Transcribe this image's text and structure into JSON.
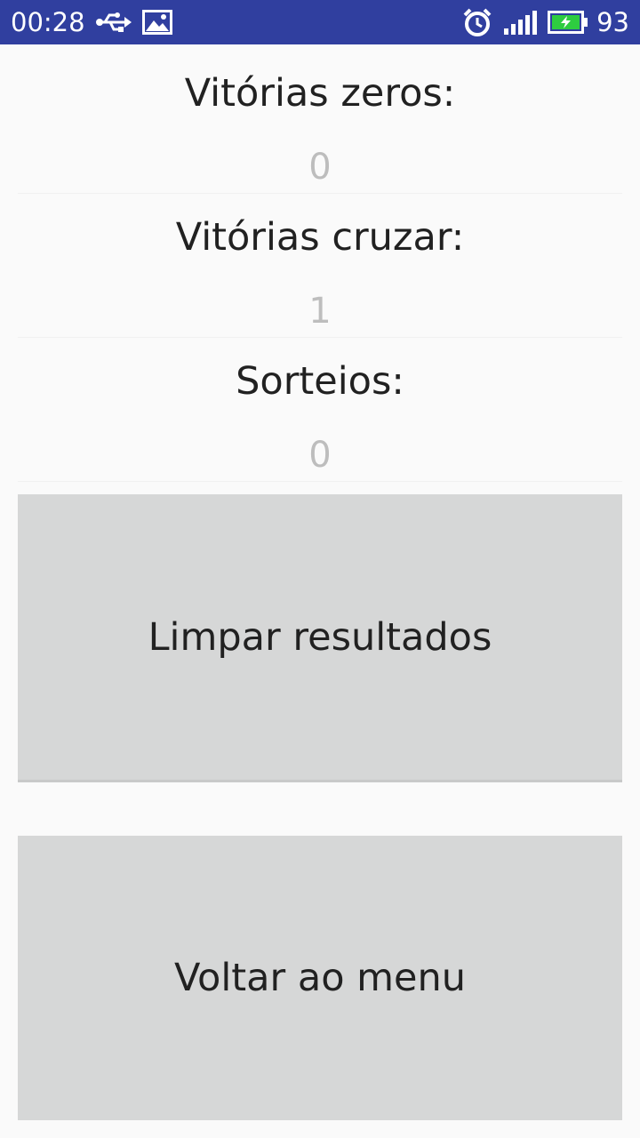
{
  "status_bar": {
    "time": "00:28",
    "battery_level": "93",
    "icons": [
      "usb-icon",
      "image-icon",
      "alarm-icon",
      "signal-icon",
      "battery-charging-icon"
    ],
    "background_color": "#303f9f"
  },
  "stats": [
    {
      "label": "Vitórias zeros:",
      "value": "0"
    },
    {
      "label": "Vitórias cruzar:",
      "value": "1"
    },
    {
      "label": "Sorteios:",
      "value": "0"
    }
  ],
  "buttons": {
    "clear_label": "Limpar resultados",
    "back_label": "Voltar ao menu"
  },
  "colors": {
    "button_background": "#d6d7d7",
    "value_hint_color": "#bdbdbd",
    "text_color": "#212121"
  }
}
